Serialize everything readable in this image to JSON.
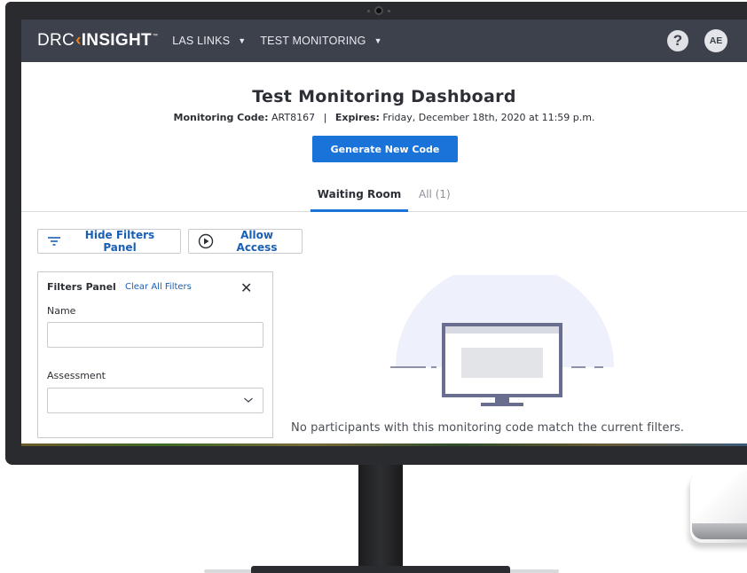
{
  "nav": {
    "logo_prefix": "DRC",
    "logo_name": "INSIGHT",
    "logo_tm": "™",
    "items": [
      {
        "label": "LAS LINKS"
      },
      {
        "label": "TEST MONITORING"
      }
    ],
    "help_label": "?",
    "avatar_initials": "AE"
  },
  "header": {
    "title": "Test Monitoring Dashboard",
    "code_label": "Monitoring Code:",
    "code_value": "ART8167",
    "separator": "|",
    "expires_label": "Expires:",
    "expires_value": "Friday, December 18th, 2020 at 11:59 p.m.",
    "generate_button": "Generate New Code"
  },
  "tabs": [
    {
      "label": "Waiting Room",
      "active": true
    },
    {
      "label": "All (1)",
      "active": false
    }
  ],
  "actions": {
    "hide_filters": "Hide Filters Panel",
    "allow_access": "Allow Access"
  },
  "filters": {
    "title": "Filters Panel",
    "clear_all": "Clear All Filters",
    "close_glyph": "✕",
    "name_label": "Name",
    "name_value": "",
    "assessment_label": "Assessment",
    "assessment_value": ""
  },
  "empty_state": {
    "message": "No participants with this monitoring code match the current filters."
  },
  "colors": {
    "navbar": "#3c414c",
    "primary_blue": "#1a73d8",
    "link_blue": "#1a5fb4",
    "logo_accent": "#e8801f",
    "illustration_circle": "#eef0fb",
    "illustration_monitor": "#6a6e8e"
  },
  "icons": {
    "help": "question-circle-icon",
    "nav_caret": "caret-down-icon",
    "filter": "filter-lines-icon",
    "allow": "play-circle-icon",
    "close": "close-icon",
    "select": "chevron-down-icon",
    "illustration": "monitor-illustration"
  }
}
